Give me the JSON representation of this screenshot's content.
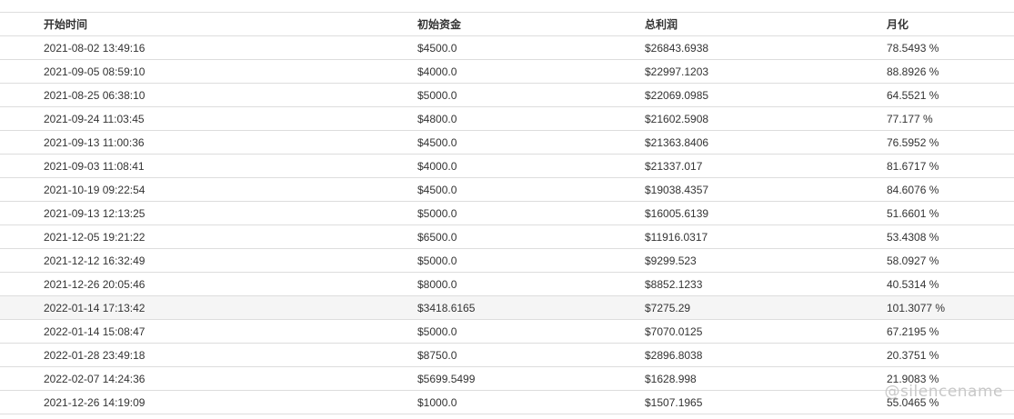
{
  "table": {
    "headers": [
      "开始时间",
      "初始资金",
      "总利润",
      "月化"
    ],
    "rows": [
      [
        "2021-08-02 13:49:16",
        "$4500.0",
        "$26843.6938",
        "78.5493 %"
      ],
      [
        "2021-09-05 08:59:10",
        "$4000.0",
        "$22997.1203",
        "88.8926 %"
      ],
      [
        "2021-08-25 06:38:10",
        "$5000.0",
        "$22069.0985",
        "64.5521 %"
      ],
      [
        "2021-09-24 11:03:45",
        "$4800.0",
        "$21602.5908",
        "77.177 %"
      ],
      [
        "2021-09-13 11:00:36",
        "$4500.0",
        "$21363.8406",
        "76.5952 %"
      ],
      [
        "2021-09-03 11:08:41",
        "$4000.0",
        "$21337.017",
        "81.6717 %"
      ],
      [
        "2021-10-19 09:22:54",
        "$4500.0",
        "$19038.4357",
        "84.6076 %"
      ],
      [
        "2021-09-13 12:13:25",
        "$5000.0",
        "$16005.6139",
        "51.6601 %"
      ],
      [
        "2021-12-05 19:21:22",
        "$6500.0",
        "$11916.0317",
        "53.4308 %"
      ],
      [
        "2021-12-12 16:32:49",
        "$5000.0",
        "$9299.523",
        "58.0927 %"
      ],
      [
        "2021-12-26 20:05:46",
        "$8000.0",
        "$8852.1233",
        "40.5314 %"
      ],
      [
        "2022-01-14 17:13:42",
        "$3418.6165",
        "$7275.29",
        "101.3077 %"
      ],
      [
        "2022-01-14 15:08:47",
        "$5000.0",
        "$7070.0125",
        "67.2195 %"
      ],
      [
        "2022-01-28 23:49:18",
        "$8750.0",
        "$2896.8038",
        "20.3751 %"
      ],
      [
        "2022-02-07 14:24:36",
        "$5699.5499",
        "$1628.998",
        "21.9083 %"
      ],
      [
        "2021-12-26 14:19:09",
        "$1000.0",
        "$1507.1965",
        "55.0465 %"
      ]
    ],
    "highlighted_row": 11
  },
  "watermark": "@silencename"
}
